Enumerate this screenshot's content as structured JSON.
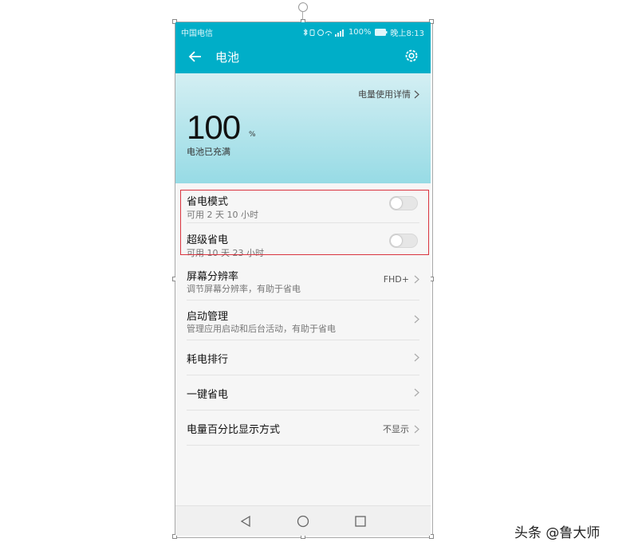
{
  "status_bar": {
    "carrier": "中国电信",
    "battery_text": "100%",
    "time": "晚上8:13"
  },
  "app_bar": {
    "title": "电池"
  },
  "hero": {
    "detail_link": "电量使用详情",
    "percent_value": "100",
    "percent_unit": "%",
    "status": "电池已充满"
  },
  "settings": [
    {
      "title": "省电模式",
      "subtitle": "可用 2 天 10 小时",
      "type": "toggle",
      "enabled": false
    },
    {
      "title": "超级省电",
      "subtitle": "可用 10 天 23 小时",
      "type": "toggle",
      "enabled": false
    },
    {
      "title": "屏幕分辨率",
      "subtitle": "调节屏幕分辨率，有助于省电",
      "type": "link",
      "value": "FHD+"
    },
    {
      "title": "启动管理",
      "subtitle": "管理应用启动和后台活动，有助于省电",
      "type": "link"
    },
    {
      "title": "耗电排行",
      "type": "link"
    },
    {
      "title": "一键省电",
      "type": "link"
    },
    {
      "title": "电量百分比显示方式",
      "type": "link",
      "value": "不显示"
    }
  ],
  "colors": {
    "accent": "#00aec8",
    "highlight_border": "#d9343f"
  },
  "icons": {
    "back": "arrow-left-icon",
    "settings": "gear-icon",
    "nav_back": "triangle-back-icon",
    "nav_home": "circle-home-icon",
    "nav_recent": "square-recent-icon"
  },
  "watermark": "头条 @鲁大师"
}
